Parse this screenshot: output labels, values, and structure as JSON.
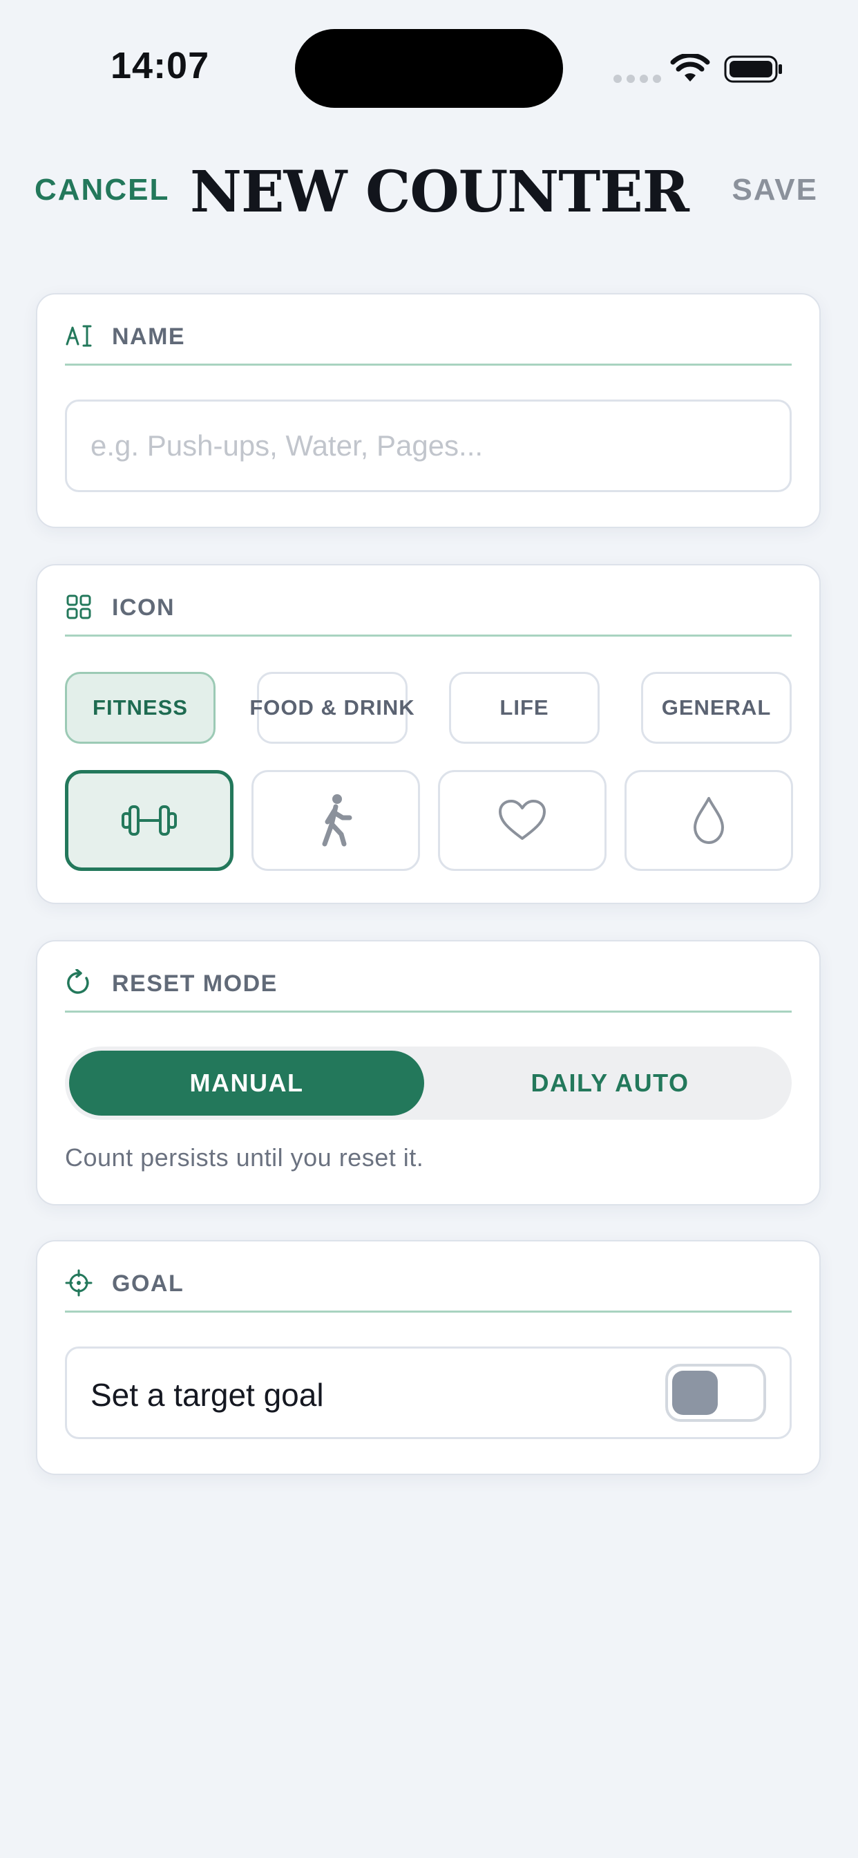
{
  "status_bar": {
    "time": "14:07"
  },
  "nav": {
    "cancel": "CANCEL",
    "title": "NEW COUNTER",
    "save": "SAVE"
  },
  "name_section": {
    "header": "NAME",
    "placeholder": "e.g. Push-ups, Water, Pages..."
  },
  "icon_section": {
    "header": "ICON",
    "categories": [
      {
        "label": "FITNESS",
        "selected": true
      },
      {
        "label": "FOOD & DRINK",
        "selected": false
      },
      {
        "label": "LIFE",
        "selected": false
      },
      {
        "label": "GENERAL",
        "selected": false
      }
    ],
    "icons": [
      {
        "icon": "dumbbell-icon",
        "selected": true
      },
      {
        "icon": "walking-icon",
        "selected": false
      },
      {
        "icon": "heart-icon",
        "selected": false
      },
      {
        "icon": "water-drop-icon",
        "selected": false
      }
    ]
  },
  "reset_section": {
    "header": "RESET MODE",
    "options": [
      "MANUAL",
      "DAILY AUTO"
    ],
    "selected": "MANUAL",
    "description": "Count persists until you reset it."
  },
  "goal_section": {
    "header": "GOAL",
    "toggle_label": "Set a target goal",
    "toggle_on": false
  },
  "colors": {
    "accent": "#23785b",
    "background": "#f1f4f8",
    "divider": "#a8d3c0"
  }
}
